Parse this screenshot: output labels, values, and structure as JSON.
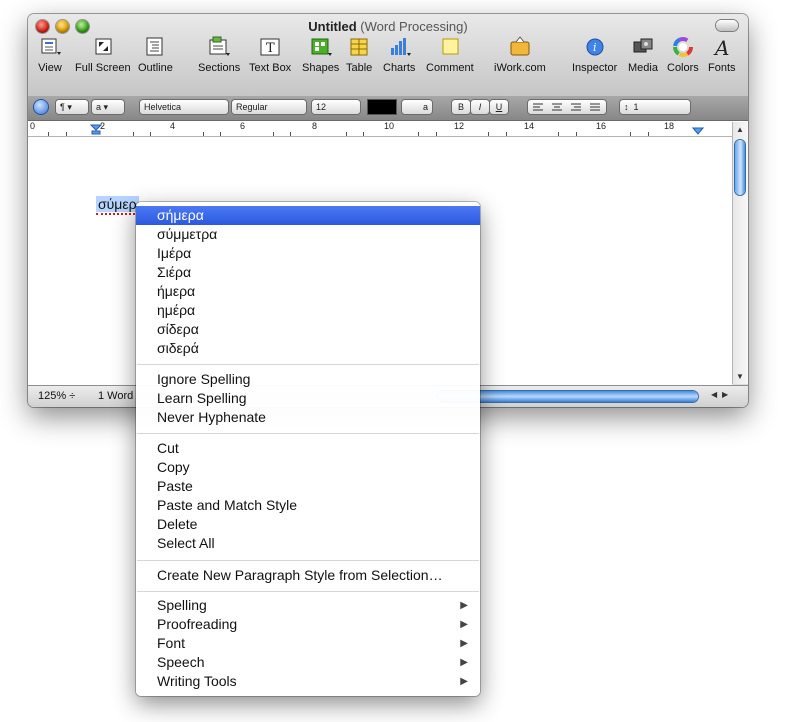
{
  "window": {
    "title_bold": "Untitled",
    "title_sub": "(Word Processing)"
  },
  "toolbar": {
    "items": [
      {
        "label": "View"
      },
      {
        "label": "Full Screen"
      },
      {
        "label": "Outline"
      },
      {
        "label": "Sections"
      },
      {
        "label": "Text Box"
      },
      {
        "label": "Shapes"
      },
      {
        "label": "Table"
      },
      {
        "label": "Charts"
      },
      {
        "label": "Comment"
      },
      {
        "label": "iWork.com"
      },
      {
        "label": "Inspector"
      },
      {
        "label": "Media"
      },
      {
        "label": "Colors"
      },
      {
        "label": "Fonts"
      }
    ]
  },
  "format_bar": {
    "paragraph_mark": "¶",
    "style_char": "a",
    "font": "Helvetica",
    "font_style": "Regular",
    "font_size": "12",
    "text_color_char": "a",
    "bold": "B",
    "italic": "I",
    "underline": "U",
    "line_spacing": "1"
  },
  "ruler": {
    "numbers": [
      "0",
      "2",
      "4",
      "6",
      "8",
      "10",
      "12",
      "14",
      "16",
      "18"
    ]
  },
  "document": {
    "selected_word": "σύμερ"
  },
  "status": {
    "zoom": "125%",
    "word_count": "1 Word"
  },
  "context_menu": {
    "suggestions": [
      "σήμερα",
      "σύμμετρα",
      "Ιμέρα",
      "Σιέρα",
      "ήμερα",
      "ημέρα",
      "σίδερα",
      "σιδερά"
    ],
    "spelling_actions": [
      "Ignore Spelling",
      "Learn Spelling",
      "Never Hyphenate"
    ],
    "edit_actions": [
      "Cut",
      "Copy",
      "Paste",
      "Paste and Match Style",
      "Delete",
      "Select All"
    ],
    "style_action": "Create New Paragraph Style from Selection…",
    "submenus": [
      "Spelling",
      "Proofreading",
      "Font",
      "Speech",
      "Writing Tools"
    ],
    "submenu_arrow": "▶"
  },
  "colors": {
    "menu_highlight": "#2a59e0",
    "selection": "#b6d4ff",
    "accent_blue": "#4b8ed8"
  }
}
